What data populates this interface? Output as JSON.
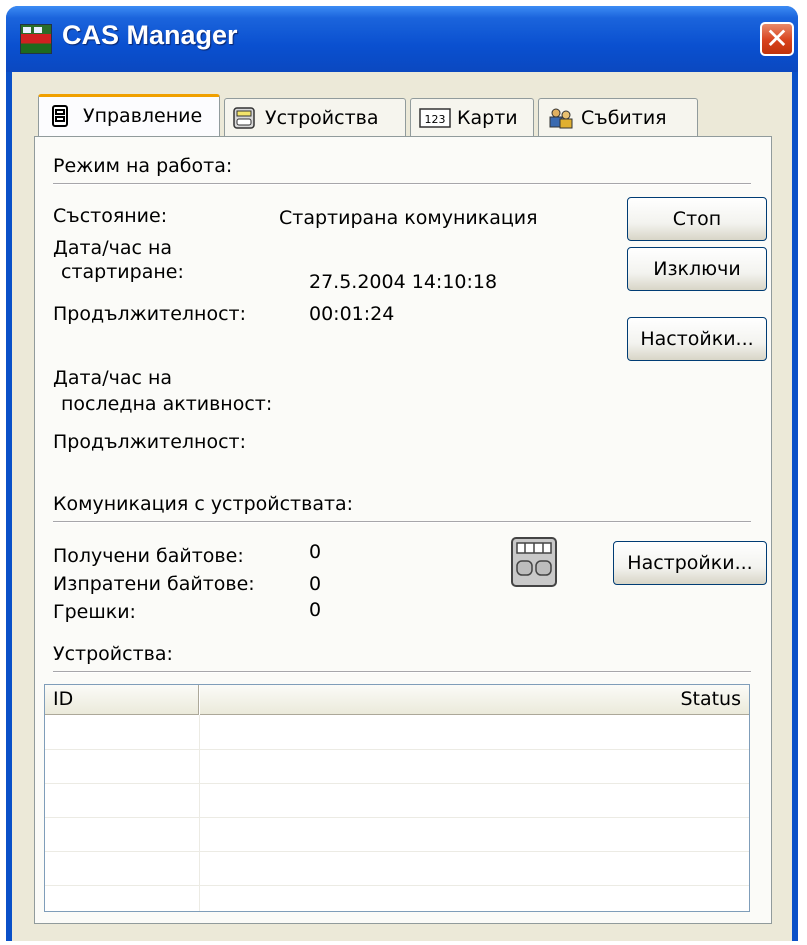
{
  "window": {
    "title": "CAS Manager",
    "close_symbol": "✕"
  },
  "tabs": [
    {
      "label": "Управление",
      "icon": "control-icon",
      "active": true
    },
    {
      "label": "Устройства",
      "icon": "device-icon",
      "active": false
    },
    {
      "label": "Карти",
      "icon": "cards-123-icon",
      "active": false
    },
    {
      "label": "Събития",
      "icon": "events-people-icon",
      "active": false
    }
  ],
  "mode": {
    "heading": "Режим на работа:",
    "status_label": "Състояние:",
    "status_value": "Стартирана комуникация",
    "start_label_1": "Дата/час на",
    "start_label_2": "стартиране:",
    "start_value": "27.5.2004 14:10:18",
    "duration_label": "Продължителност:",
    "duration_value": "00:01:24",
    "last_label_1": "Дата/час на",
    "last_label_2": "последна активност:",
    "last_duration_label": "Продължителност:",
    "last_duration_value": ""
  },
  "buttons": {
    "stop": "Стоп",
    "shutdown": "Изключи",
    "settings": "Настойки...",
    "comm_settings": "Настройки..."
  },
  "comm": {
    "heading": "Комуникация с устройствата:",
    "received_label": "Получени байтове:",
    "received_value": "0",
    "sent_label": "Изпратени байтове:",
    "sent_value": "0",
    "errors_label": "Грешки:",
    "errors_value": "0"
  },
  "devices": {
    "heading": "Устройства:",
    "columns": [
      "ID",
      "Status"
    ],
    "rows": []
  }
}
